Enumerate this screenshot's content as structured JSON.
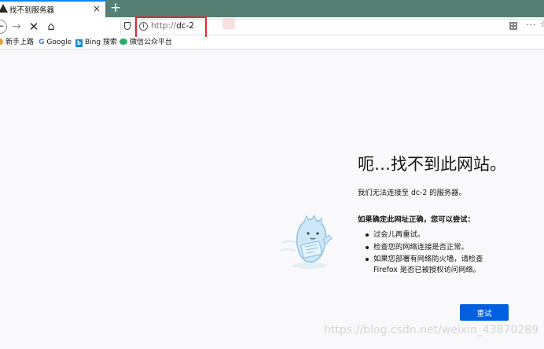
{
  "tab": {
    "title": "找不到服务器",
    "close": "×"
  },
  "newtab": "+",
  "nav": {
    "back": "←",
    "forward": "→",
    "stop": "✕",
    "home": "⌂"
  },
  "url": {
    "scheme": "http://",
    "host": "dc-2",
    "info_glyph": "i",
    "more": "···",
    "star": "☆"
  },
  "bookmarks": [
    {
      "label": "新手上路",
      "icon": "firefox-icon"
    },
    {
      "label": "Google",
      "icon": "google-icon",
      "glyph": "G"
    },
    {
      "label": "Bing 搜索",
      "icon": "bing-icon",
      "glyph": "b"
    },
    {
      "label": "微信公众平台",
      "icon": "wechat-icon"
    }
  ],
  "error": {
    "title": "呃…找不到此网站。",
    "description": "我们无法连接至 dc-2 的服务器。",
    "subtitle": "如果确定此网址正确，您可以尝试：",
    "tips": [
      "过会儿再重试。",
      "检查您的网络连接是否正常。",
      "如果您部署有网络防火墙，请检查",
      "Firefox 是否已被授权访问网络。"
    ],
    "retry": "重试"
  },
  "watermark": "https://blog.csdn.net/weixin_43870289",
  "colors": {
    "tabstrip": "#547f72",
    "accent": "#0060df",
    "highlight": "#e8262b",
    "page_bg": "#f9f9fb"
  }
}
